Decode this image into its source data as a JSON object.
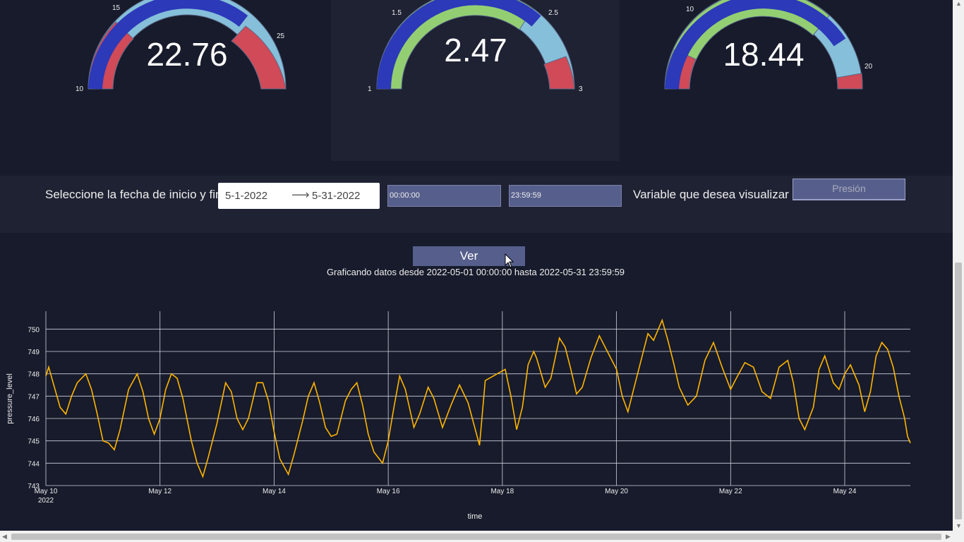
{
  "gauges": [
    {
      "value": "22.76",
      "ticks": [
        "10",
        "15",
        "25"
      ],
      "value_num": 22.76,
      "range": [
        10,
        25
      ]
    },
    {
      "value": "2.47",
      "ticks": [
        "1",
        "1.5",
        "2.5",
        "3"
      ],
      "value_num": 2.47,
      "range": [
        1,
        3
      ]
    },
    {
      "value": "18.44",
      "ticks": [
        "10",
        "20"
      ],
      "value_num": 18.44,
      "range": [
        5,
        20
      ]
    }
  ],
  "filter": {
    "date_label": "Seleccione la fecha de inicio y fin",
    "start_date": "5-1-2022",
    "end_date": "5-31-2022",
    "start_time": "00:00:00",
    "end_time": "23:59:59",
    "variable_label": "Variable que desea visualizar",
    "variable_value": "Presión"
  },
  "ver_label": "Ver",
  "status_text": "Graficando datos desde 2022-05-01 00:00:00 hasta 2022-05-31 23:59:59",
  "chart_data": {
    "type": "line",
    "xlabel": "time",
    "ylabel": "pressure_level",
    "x_ticks": [
      "May 10\n2022",
      "May 12",
      "May 14",
      "May 16",
      "May 18",
      "May 20",
      "May 22",
      "May 24"
    ],
    "y_ticks": [
      "743",
      "744",
      "745",
      "746",
      "747",
      "748",
      "749",
      "750"
    ],
    "ylim": [
      743,
      750.8
    ],
    "xlim_days": [
      10,
      25.15
    ],
    "series": [
      {
        "color": "#ffb400",
        "points": [
          [
            10.0,
            747.9
          ],
          [
            10.05,
            748.3
          ],
          [
            10.15,
            747.4
          ],
          [
            10.25,
            746.5
          ],
          [
            10.35,
            746.2
          ],
          [
            10.45,
            747
          ],
          [
            10.55,
            747.6
          ],
          [
            10.7,
            748
          ],
          [
            10.8,
            747.3
          ],
          [
            10.9,
            746.2
          ],
          [
            11.0,
            745
          ],
          [
            11.1,
            744.9
          ],
          [
            11.2,
            744.6
          ],
          [
            11.3,
            745.5
          ],
          [
            11.45,
            747.3
          ],
          [
            11.6,
            748
          ],
          [
            11.7,
            747.2
          ],
          [
            11.8,
            746
          ],
          [
            11.9,
            745.3
          ],
          [
            12.0,
            746
          ],
          [
            12.1,
            747.3
          ],
          [
            12.2,
            748
          ],
          [
            12.3,
            747.8
          ],
          [
            12.4,
            746.9
          ],
          [
            12.55,
            745
          ],
          [
            12.65,
            744
          ],
          [
            12.75,
            743.4
          ],
          [
            12.85,
            744.3
          ],
          [
            13.0,
            745.8
          ],
          [
            13.15,
            747.6
          ],
          [
            13.25,
            747.2
          ],
          [
            13.35,
            746
          ],
          [
            13.45,
            745.5
          ],
          [
            13.55,
            746
          ],
          [
            13.7,
            747.6
          ],
          [
            13.8,
            747.6
          ],
          [
            13.9,
            746.8
          ],
          [
            14.0,
            745.4
          ],
          [
            14.1,
            744.2
          ],
          [
            14.25,
            743.5
          ],
          [
            14.35,
            744.4
          ],
          [
            14.5,
            745.9
          ],
          [
            14.6,
            747
          ],
          [
            14.7,
            747.6
          ],
          [
            14.8,
            746.7
          ],
          [
            14.9,
            745.6
          ],
          [
            15.0,
            745.2
          ],
          [
            15.1,
            745.3
          ],
          [
            15.25,
            746.8
          ],
          [
            15.35,
            747.3
          ],
          [
            15.45,
            747.6
          ],
          [
            15.55,
            746.6
          ],
          [
            15.65,
            745.3
          ],
          [
            15.75,
            744.5
          ],
          [
            15.9,
            744
          ],
          [
            16.0,
            745
          ],
          [
            16.1,
            746.5
          ],
          [
            16.2,
            747.9
          ],
          [
            16.3,
            747.3
          ],
          [
            16.45,
            745.6
          ],
          [
            16.55,
            746.2
          ],
          [
            16.7,
            747.4
          ],
          [
            16.8,
            746.9
          ],
          [
            16.95,
            745.6
          ],
          [
            17.1,
            746.6
          ],
          [
            17.25,
            747.5
          ],
          [
            17.4,
            746.7
          ],
          [
            17.6,
            744.8
          ],
          [
            17.7,
            747.7
          ],
          [
            18.05,
            748.2
          ],
          [
            18.15,
            747
          ],
          [
            18.25,
            745.5
          ],
          [
            18.35,
            746.5
          ],
          [
            18.45,
            748.4
          ],
          [
            18.55,
            749
          ],
          [
            18.6,
            748.7
          ],
          [
            18.75,
            747.4
          ],
          [
            18.85,
            747.8
          ],
          [
            19.0,
            749.6
          ],
          [
            19.1,
            749.2
          ],
          [
            19.2,
            748.2
          ],
          [
            19.3,
            747.1
          ],
          [
            19.4,
            747.4
          ],
          [
            19.55,
            748.7
          ],
          [
            19.7,
            749.7
          ],
          [
            19.8,
            749.2
          ],
          [
            19.9,
            748.7
          ],
          [
            20.0,
            748.2
          ],
          [
            20.1,
            747
          ],
          [
            20.2,
            746.3
          ],
          [
            20.3,
            747.3
          ],
          [
            20.45,
            748.8
          ],
          [
            20.55,
            749.8
          ],
          [
            20.65,
            749.5
          ],
          [
            20.8,
            750.4
          ],
          [
            20.9,
            749.5
          ],
          [
            21.0,
            748.5
          ],
          [
            21.1,
            747.4
          ],
          [
            21.25,
            746.6
          ],
          [
            21.4,
            747
          ],
          [
            21.55,
            748.6
          ],
          [
            21.7,
            749.4
          ],
          [
            21.85,
            748.3
          ],
          [
            22.0,
            747.3
          ],
          [
            22.1,
            747.8
          ],
          [
            22.25,
            748.5
          ],
          [
            22.4,
            748.3
          ],
          [
            22.55,
            747.2
          ],
          [
            22.7,
            746.9
          ],
          [
            22.85,
            748.3
          ],
          [
            23.0,
            748.6
          ],
          [
            23.1,
            747.6
          ],
          [
            23.2,
            746
          ],
          [
            23.3,
            745.5
          ],
          [
            23.45,
            746.5
          ],
          [
            23.55,
            748.2
          ],
          [
            23.65,
            748.8
          ],
          [
            23.8,
            747.6
          ],
          [
            23.9,
            747.3
          ],
          [
            24.0,
            748
          ],
          [
            24.1,
            748.4
          ],
          [
            24.25,
            747.5
          ],
          [
            24.35,
            746.3
          ],
          [
            24.45,
            747.2
          ],
          [
            24.55,
            748.8
          ],
          [
            24.65,
            749.4
          ],
          [
            24.75,
            749.1
          ],
          [
            24.85,
            748.3
          ],
          [
            24.95,
            747
          ],
          [
            25.05,
            746
          ],
          [
            25.1,
            745.2
          ],
          [
            25.15,
            744.9
          ]
        ]
      }
    ]
  }
}
